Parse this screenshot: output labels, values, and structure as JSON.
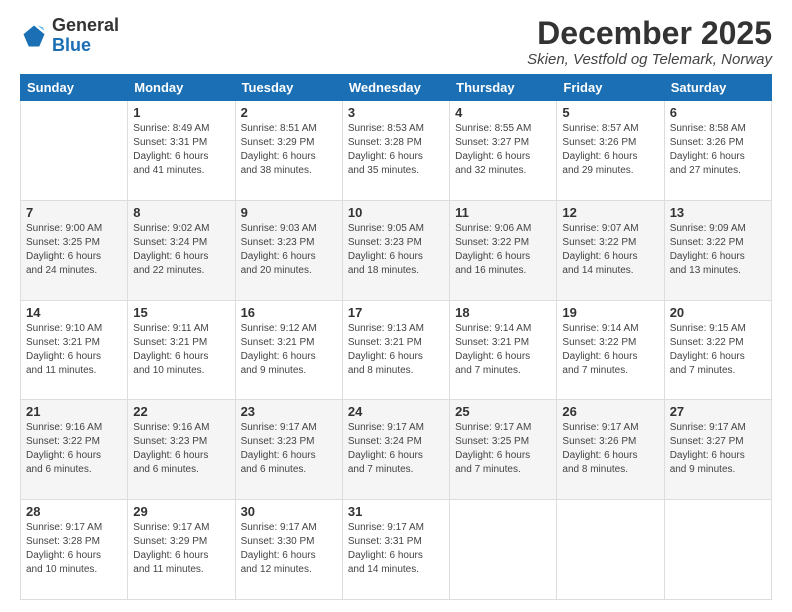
{
  "logo": {
    "general": "General",
    "blue": "Blue"
  },
  "header": {
    "title": "December 2025",
    "subtitle": "Skien, Vestfold og Telemark, Norway"
  },
  "weekdays": [
    "Sunday",
    "Monday",
    "Tuesday",
    "Wednesday",
    "Thursday",
    "Friday",
    "Saturday"
  ],
  "weeks": [
    [
      {
        "day": "",
        "info": ""
      },
      {
        "day": "1",
        "info": "Sunrise: 8:49 AM\nSunset: 3:31 PM\nDaylight: 6 hours\nand 41 minutes."
      },
      {
        "day": "2",
        "info": "Sunrise: 8:51 AM\nSunset: 3:29 PM\nDaylight: 6 hours\nand 38 minutes."
      },
      {
        "day": "3",
        "info": "Sunrise: 8:53 AM\nSunset: 3:28 PM\nDaylight: 6 hours\nand 35 minutes."
      },
      {
        "day": "4",
        "info": "Sunrise: 8:55 AM\nSunset: 3:27 PM\nDaylight: 6 hours\nand 32 minutes."
      },
      {
        "day": "5",
        "info": "Sunrise: 8:57 AM\nSunset: 3:26 PM\nDaylight: 6 hours\nand 29 minutes."
      },
      {
        "day": "6",
        "info": "Sunrise: 8:58 AM\nSunset: 3:26 PM\nDaylight: 6 hours\nand 27 minutes."
      }
    ],
    [
      {
        "day": "7",
        "info": "Sunrise: 9:00 AM\nSunset: 3:25 PM\nDaylight: 6 hours\nand 24 minutes."
      },
      {
        "day": "8",
        "info": "Sunrise: 9:02 AM\nSunset: 3:24 PM\nDaylight: 6 hours\nand 22 minutes."
      },
      {
        "day": "9",
        "info": "Sunrise: 9:03 AM\nSunset: 3:23 PM\nDaylight: 6 hours\nand 20 minutes."
      },
      {
        "day": "10",
        "info": "Sunrise: 9:05 AM\nSunset: 3:23 PM\nDaylight: 6 hours\nand 18 minutes."
      },
      {
        "day": "11",
        "info": "Sunrise: 9:06 AM\nSunset: 3:22 PM\nDaylight: 6 hours\nand 16 minutes."
      },
      {
        "day": "12",
        "info": "Sunrise: 9:07 AM\nSunset: 3:22 PM\nDaylight: 6 hours\nand 14 minutes."
      },
      {
        "day": "13",
        "info": "Sunrise: 9:09 AM\nSunset: 3:22 PM\nDaylight: 6 hours\nand 13 minutes."
      }
    ],
    [
      {
        "day": "14",
        "info": "Sunrise: 9:10 AM\nSunset: 3:21 PM\nDaylight: 6 hours\nand 11 minutes."
      },
      {
        "day": "15",
        "info": "Sunrise: 9:11 AM\nSunset: 3:21 PM\nDaylight: 6 hours\nand 10 minutes."
      },
      {
        "day": "16",
        "info": "Sunrise: 9:12 AM\nSunset: 3:21 PM\nDaylight: 6 hours\nand 9 minutes."
      },
      {
        "day": "17",
        "info": "Sunrise: 9:13 AM\nSunset: 3:21 PM\nDaylight: 6 hours\nand 8 minutes."
      },
      {
        "day": "18",
        "info": "Sunrise: 9:14 AM\nSunset: 3:21 PM\nDaylight: 6 hours\nand 7 minutes."
      },
      {
        "day": "19",
        "info": "Sunrise: 9:14 AM\nSunset: 3:22 PM\nDaylight: 6 hours\nand 7 minutes."
      },
      {
        "day": "20",
        "info": "Sunrise: 9:15 AM\nSunset: 3:22 PM\nDaylight: 6 hours\nand 7 minutes."
      }
    ],
    [
      {
        "day": "21",
        "info": "Sunrise: 9:16 AM\nSunset: 3:22 PM\nDaylight: 6 hours\nand 6 minutes."
      },
      {
        "day": "22",
        "info": "Sunrise: 9:16 AM\nSunset: 3:23 PM\nDaylight: 6 hours\nand 6 minutes."
      },
      {
        "day": "23",
        "info": "Sunrise: 9:17 AM\nSunset: 3:23 PM\nDaylight: 6 hours\nand 6 minutes."
      },
      {
        "day": "24",
        "info": "Sunrise: 9:17 AM\nSunset: 3:24 PM\nDaylight: 6 hours\nand 7 minutes."
      },
      {
        "day": "25",
        "info": "Sunrise: 9:17 AM\nSunset: 3:25 PM\nDaylight: 6 hours\nand 7 minutes."
      },
      {
        "day": "26",
        "info": "Sunrise: 9:17 AM\nSunset: 3:26 PM\nDaylight: 6 hours\nand 8 minutes."
      },
      {
        "day": "27",
        "info": "Sunrise: 9:17 AM\nSunset: 3:27 PM\nDaylight: 6 hours\nand 9 minutes."
      }
    ],
    [
      {
        "day": "28",
        "info": "Sunrise: 9:17 AM\nSunset: 3:28 PM\nDaylight: 6 hours\nand 10 minutes."
      },
      {
        "day": "29",
        "info": "Sunrise: 9:17 AM\nSunset: 3:29 PM\nDaylight: 6 hours\nand 11 minutes."
      },
      {
        "day": "30",
        "info": "Sunrise: 9:17 AM\nSunset: 3:30 PM\nDaylight: 6 hours\nand 12 minutes."
      },
      {
        "day": "31",
        "info": "Sunrise: 9:17 AM\nSunset: 3:31 PM\nDaylight: 6 hours\nand 14 minutes."
      },
      {
        "day": "",
        "info": ""
      },
      {
        "day": "",
        "info": ""
      },
      {
        "day": "",
        "info": ""
      }
    ]
  ]
}
